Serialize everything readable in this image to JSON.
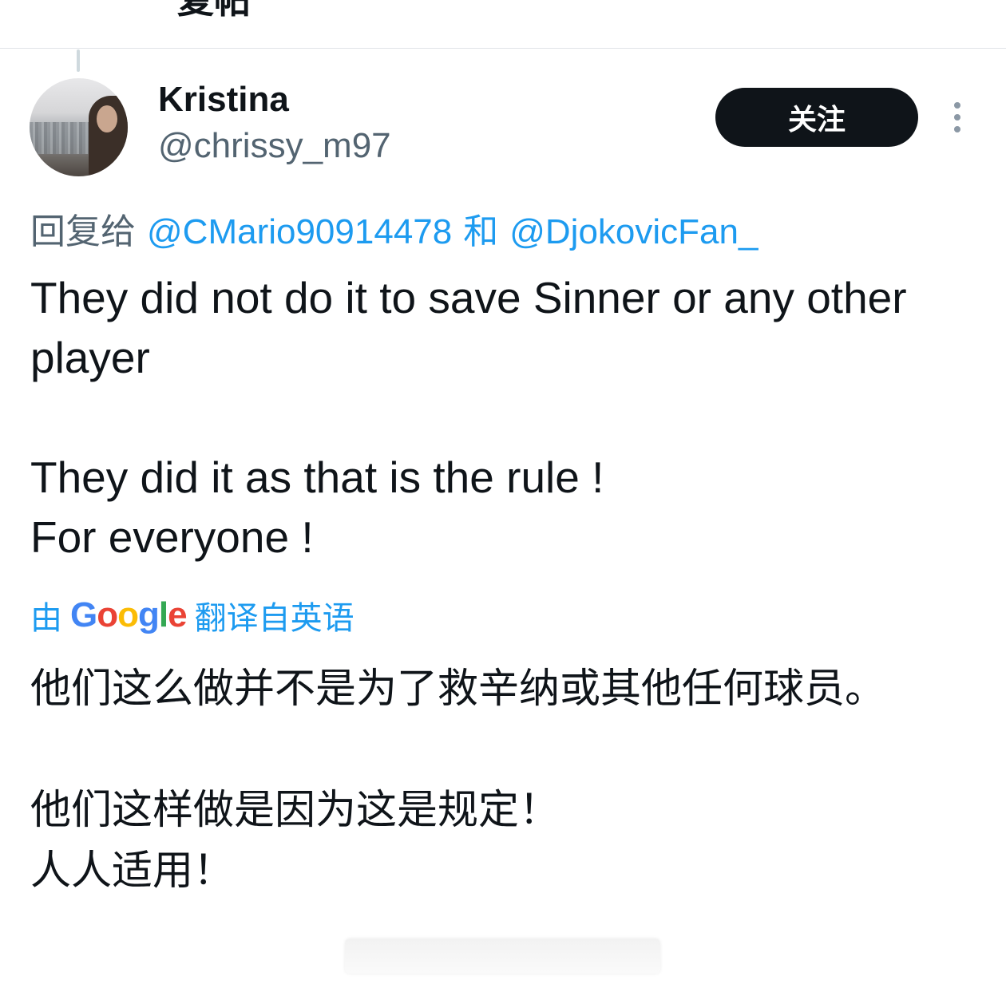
{
  "header": {
    "title": "复帖"
  },
  "tweet": {
    "author_name": "Kristina",
    "author_handle": "@chrissy_m97",
    "follow_label": "关注",
    "reply_prefix": "回复给",
    "reply_mention_1": "@CMario90914478",
    "reply_connector": "和",
    "reply_mention_2": "@DjokovicFan_",
    "text": "They did not do it to save Sinner or any other player\n\nThey did it as that is the rule !\nFor everyone !",
    "translated_by_prefix": "由",
    "translated_by_brand": "Google",
    "translated_by_suffix": "翻译自英语",
    "translation": "他们这么做并不是为了救辛纳或其他任何球员。\n\n他们这样做是因为这是规定！\n人人适用！"
  },
  "icons": {
    "more": "more-vertical-icon",
    "avatar": "profile-photo"
  },
  "colors": {
    "link": "#1d9bf0",
    "secondary_text": "#536471",
    "follow_button_bg": "#0f1419"
  }
}
